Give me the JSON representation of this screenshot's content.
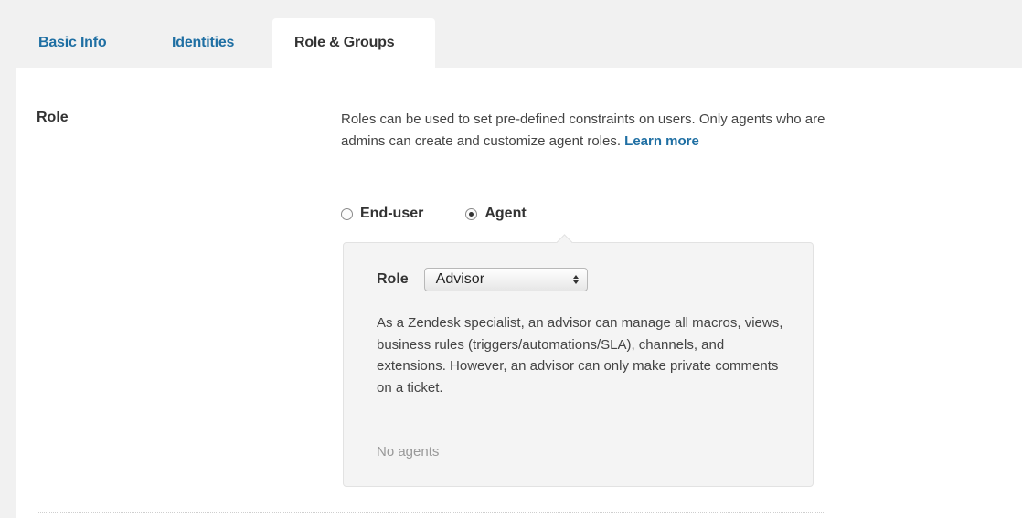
{
  "tabs": [
    {
      "label": "Basic Info",
      "active": false
    },
    {
      "label": "Identities",
      "active": false
    },
    {
      "label": "Role & Groups",
      "active": true
    }
  ],
  "role_section": {
    "label": "Role",
    "description": "Roles can be used to set pre-defined constraints on users. Only agents who are admins can create and customize agent roles.",
    "learn_more": "Learn more",
    "radio_options": [
      {
        "label": "End-user",
        "checked": false
      },
      {
        "label": "Agent",
        "checked": true
      }
    ],
    "agent_role": {
      "label": "Role",
      "selected_value": "Advisor",
      "description": "As a Zendesk specialist, an advisor can manage all macros, views, business rules (triggers/automations/SLA), channels, and extensions. However, an advisor can only make private comments on a ticket.",
      "agents_status": "No agents"
    }
  },
  "colors": {
    "link": "#1f6fa3",
    "background": "#f1f1f1",
    "panel": "#ffffff",
    "muted_text": "#999999"
  }
}
